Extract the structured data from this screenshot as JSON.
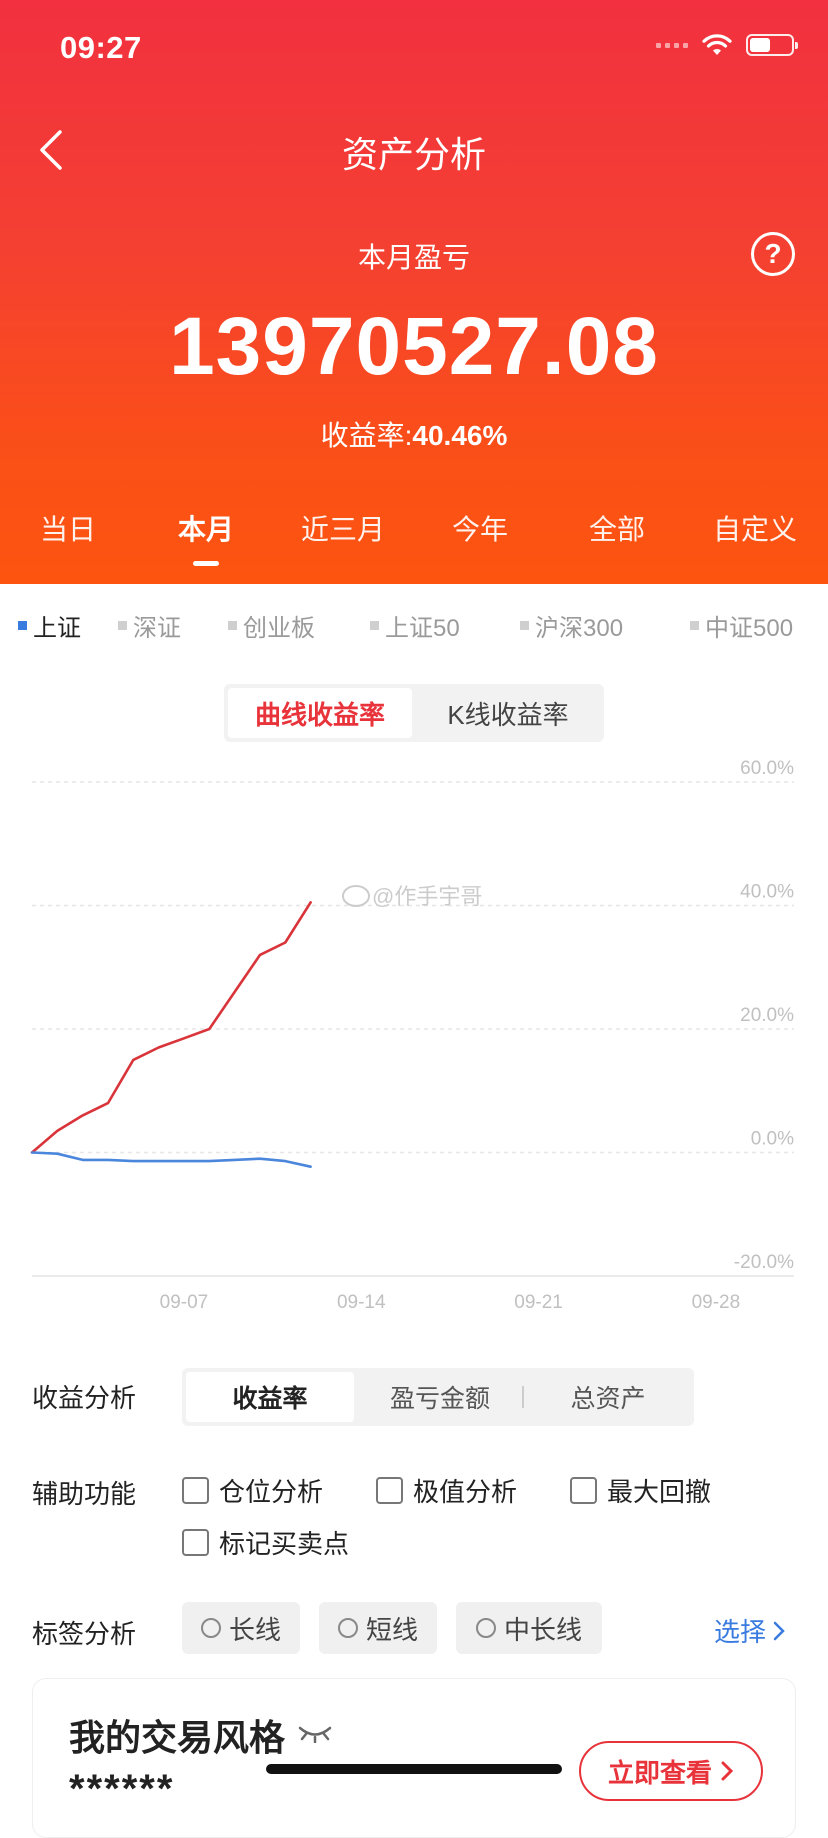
{
  "status": {
    "time": "09:27"
  },
  "header": {
    "title": "资产分析",
    "pl_label": "本月盈亏",
    "pl_value": "13970527.08",
    "rate_label": "收益率:",
    "rate_value": "40.46%",
    "help": "?"
  },
  "period_tabs": [
    {
      "label": "当日"
    },
    {
      "label": "本月"
    },
    {
      "label": "近三月"
    },
    {
      "label": "今年"
    },
    {
      "label": "全部"
    },
    {
      "label": "自定义"
    }
  ],
  "period_active": "本月",
  "index_tabs": [
    {
      "label": "上证"
    },
    {
      "label": "深证"
    },
    {
      "label": "创业板"
    },
    {
      "label": "上证50"
    },
    {
      "label": "沪深300"
    },
    {
      "label": "中证500"
    }
  ],
  "index_active": "上证",
  "curve_tabs": {
    "active": "曲线收益率",
    "other": "K线收益率"
  },
  "chart_data": {
    "type": "line",
    "y_ticks": [
      "60.0%",
      "40.0%",
      "20.0%",
      "0.0%",
      "-20.0%"
    ],
    "x_ticks": [
      "09-07",
      "09-14",
      "09-21",
      "09-28"
    ],
    "ylim": [
      -20,
      60
    ],
    "grid": true,
    "watermark": "@作手宇哥",
    "series": [
      {
        "color": "#d8343a",
        "x": [
          "09-01",
          "09-02",
          "09-03",
          "09-04",
          "09-05",
          "09-06",
          "09-07",
          "09-08",
          "09-09",
          "09-10",
          "09-11",
          "09-12"
        ],
        "values": [
          0,
          3.5,
          6,
          8,
          15,
          17,
          18.5,
          20,
          26,
          32,
          34,
          40.5
        ]
      },
      {
        "color": "#4a86dc",
        "x": [
          "09-01",
          "09-02",
          "09-03",
          "09-04",
          "09-05",
          "09-06",
          "09-07",
          "09-08",
          "09-09",
          "09-10",
          "09-11",
          "09-12"
        ],
        "values": [
          0,
          -0.2,
          -1.2,
          -1.2,
          -1.4,
          -1.4,
          -1.4,
          -1.4,
          -1.2,
          -1.0,
          -1.4,
          -2.3
        ]
      }
    ]
  },
  "analysis": {
    "label": "收益分析",
    "tabs": {
      "active": "收益率",
      "pl_amount": "盈亏金额",
      "total_assets": "总资产"
    }
  },
  "aux": {
    "label": "辅助功能",
    "options": {
      "position": "仓位分析",
      "extreme": "极值分析",
      "drawdown": "最大回撤",
      "trades": "标记买卖点"
    }
  },
  "tags": {
    "label": "标签分析",
    "long": "长线",
    "short": "短线",
    "mid": "中长线",
    "select": "选择"
  },
  "style": {
    "title": "我的交易风格",
    "masked": "******",
    "view_button": "立即查看"
  }
}
